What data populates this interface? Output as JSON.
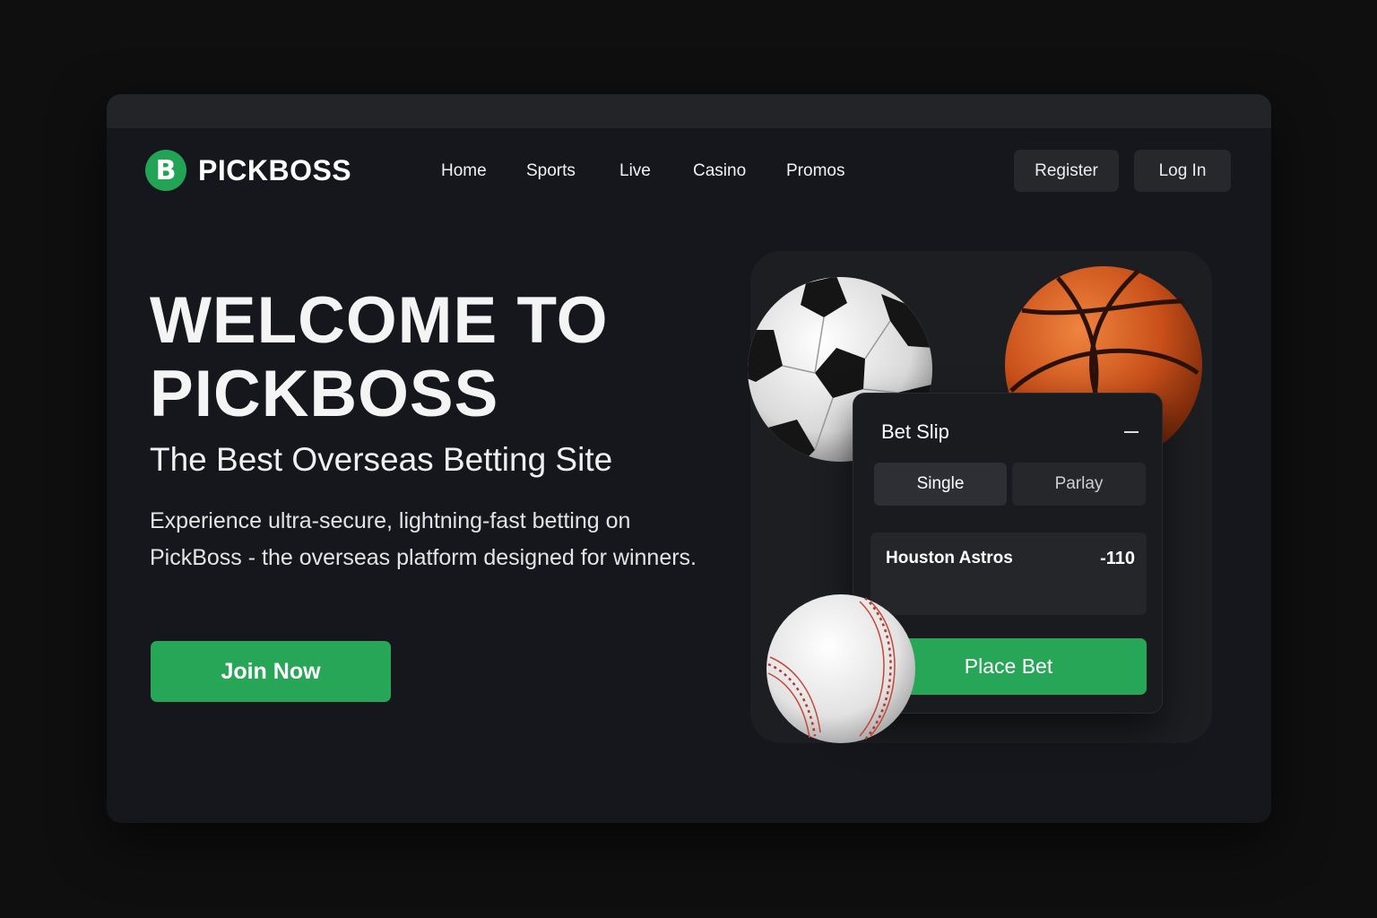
{
  "brand": {
    "logo_letter": "B",
    "name": "PICKBOSS",
    "accent": "#27a657"
  },
  "nav": {
    "links": [
      "Home",
      "Sports",
      "Live",
      "Casino",
      "Promos"
    ],
    "register_label": "Register",
    "login_label": "Log In"
  },
  "hero": {
    "title": "WELCOME TO PICKBOSS",
    "subtitle": "The Best Overseas Betting Site",
    "description": "Experience ultra-secure, lightning-fast betting on PickBoss - the overseas platform designed for winners.",
    "cta_label": "Join Now"
  },
  "bet_slip": {
    "title": "Bet Slip",
    "tabs": [
      {
        "label": "Single",
        "active": true
      },
      {
        "label": "Parlay",
        "active": false
      }
    ],
    "selection": {
      "team": "Houston Astros",
      "odds": "-110"
    },
    "place_label": "Place Bet"
  },
  "icons": [
    "soccer-ball-icon",
    "basketball-icon",
    "baseball-icon",
    "minimize-icon"
  ]
}
